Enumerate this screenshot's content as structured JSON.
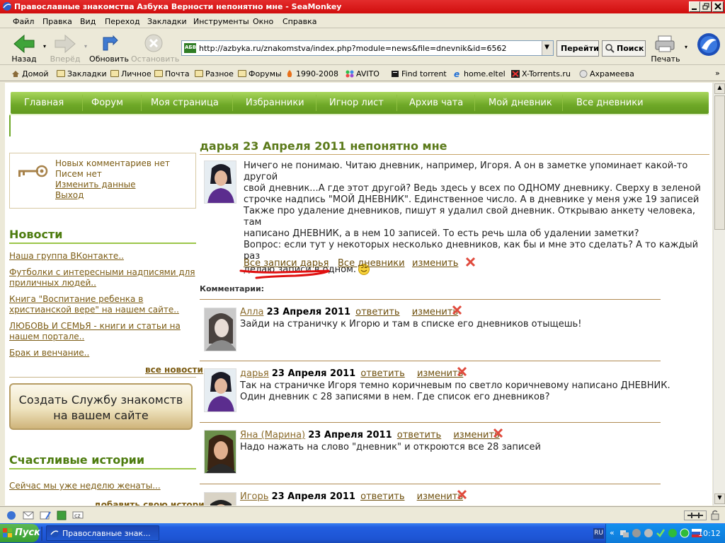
{
  "window": {
    "title": "Православные знакомства Азбука Верности непонятно мне - SeaMonkey"
  },
  "menu": [
    "Файл",
    "Правка",
    "Вид",
    "Переход",
    "Закладки",
    "Инструменты",
    "Окно",
    "Справка"
  ],
  "toolbar": {
    "back": "Назад",
    "forward": "Вперёд",
    "reload": "Обновить",
    "stop": "Остановить",
    "url": "http://azbyka.ru/znakomstva/index.php?module=news&file=dnevnik&id=6562",
    "go": "Перейти",
    "search": "Поиск",
    "print": "Печать"
  },
  "bookmarks": [
    "Домой",
    "Закладки",
    "Личное",
    "Почта",
    "Разное",
    "Форумы",
    "1990-2008",
    "AVITO",
    "Find torrent",
    "home.eltel",
    "X-Torrents.ru",
    "Ахрамеева"
  ],
  "sitenav": [
    "Главная",
    "Форум",
    "Моя страница",
    "Избранники",
    "Игнор лист",
    "Архив чата",
    "Мой дневник",
    "Все дневники"
  ],
  "userbox": {
    "comments": "Новых комментариев нет",
    "letters": "Писем нет",
    "change": "Изменить данные",
    "logout": "Выход"
  },
  "news": {
    "title": "Новости",
    "items": [
      "Наша группа ВКонтакте..",
      "Футболки с интересными надписями для приличных людей..",
      "Книга \"Воспитание ребенка в христианской вере\" на нашем сайте..",
      "ЛЮБОВЬ И СЕМЬЯ - книги и статьи на нашем портале..",
      "Брак и венчание.."
    ],
    "all": "все новости"
  },
  "promo": {
    "line1": "Создать Службу знакомств",
    "line2": "на вашем сайте"
  },
  "stories": {
    "title": "Счастливые истории",
    "item": "Сейчас мы уже неделю женаты...",
    "add": "добавить свою историю"
  },
  "post": {
    "title": "дарья 23 Апреля 2011  непонятно мне",
    "lines": [
      "Ничего не понимаю. Читаю дневник, например, Игоря. А он в заметке упоминает какой-то другой",
      "свой дневник...А где этот другой? Ведь здесь у всех по ОДНОМУ дневнику. Сверху в зеленой",
      "строчке надпись \"МОЙ ДНЕВНИК\". Единственное число. А в дневнике у меня уже 19 записей",
      "Также про удаление дневников, пишут я удалил свой дневник. Открываю анкету человека, там",
      "написано ДНЕВНИК, а в нем 10 записей. То есть речь шла об удалении заметки?",
      "Вопрос: если тут у некоторых несколько дневников, как бы и мне это сделать? А то каждый раз",
      "делаю записи в одном."
    ],
    "links": {
      "all_posts": "Все записи дарья",
      "all_diaries": "Все дневники",
      "edit": "изменить"
    }
  },
  "comments_label": "Комментарии:",
  "comments": [
    {
      "author": "Алла",
      "date": "23 Апреля 2011",
      "reply": "ответить",
      "edit": "изменить",
      "lines": [
        "Зайди на страничку к Игорю и там в списке его дневников отыщешь!"
      ]
    },
    {
      "author": "дарья",
      "date": "23 Апреля 2011",
      "reply": "ответить",
      "edit": "изменить",
      "lines": [
        "Так на страничке Игоря темно коричневым по светло коричневому написано ДНЕВНИК.",
        "Один дневник с 28 записями в нем. Где список его дневников?"
      ]
    },
    {
      "author": "Яна (Марина)",
      "date": "23 Апреля 2011",
      "reply": "ответить",
      "edit": "изменить",
      "lines": [
        "Надо нажать на слово \"дневник\" и откроются все 28 записей"
      ]
    },
    {
      "author": "Игорь",
      "date": "23 Апреля 2011",
      "reply": "ответить",
      "edit": "изменить",
      "lines": [
        ""
      ]
    }
  ],
  "taskbar": {
    "start": "Пуск",
    "task": "Православные знак...",
    "lang": "RU",
    "clock": "10:12"
  },
  "colors": {
    "nav_green": "#6ea827",
    "title_green": "#4d7c0f",
    "link_brown": "#7c5c14",
    "titlebar_red": "#d10e0e"
  }
}
